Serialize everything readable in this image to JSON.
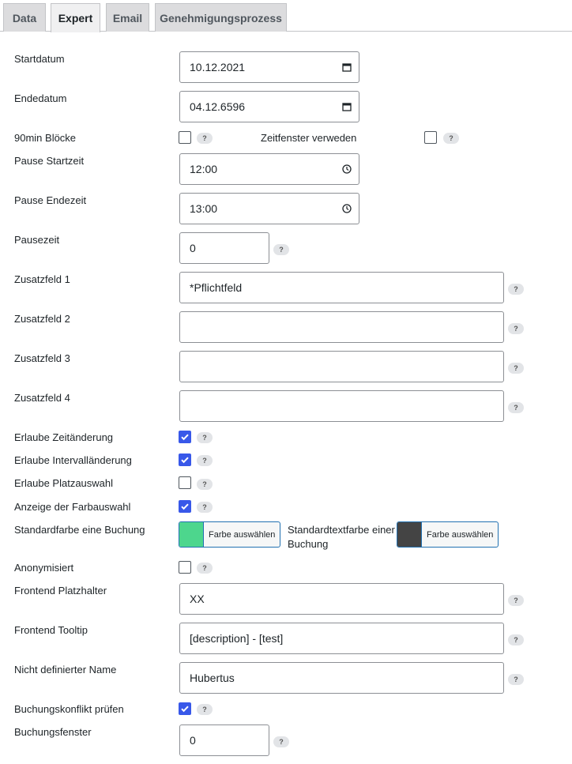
{
  "tabs": [
    {
      "label": "Data"
    },
    {
      "label": "Expert"
    },
    {
      "label": "Email"
    },
    {
      "label": "Genehmigungsprozess"
    }
  ],
  "help_glyph": "?",
  "fields": {
    "startdatum": {
      "label": "Startdatum",
      "value": "10.12.2021"
    },
    "endedatum": {
      "label": "Endedatum",
      "value": "04.12.6596"
    },
    "bloecke90": {
      "label": "90min Blöcke",
      "checked": false
    },
    "zeitfenster": {
      "label": "Zeitfenster verweden",
      "checked": false
    },
    "pause_start": {
      "label": "Pause Startzeit",
      "value": "12:00"
    },
    "pause_ende": {
      "label": "Pause Endezeit",
      "value": "13:00"
    },
    "pausezeit": {
      "label": "Pausezeit",
      "value": "0"
    },
    "zusatz1": {
      "label": "Zusatzfeld 1",
      "value": "*Pflichtfeld"
    },
    "zusatz2": {
      "label": "Zusatzfeld 2",
      "value": ""
    },
    "zusatz3": {
      "label": "Zusatzfeld 3",
      "value": ""
    },
    "zusatz4": {
      "label": "Zusatzfeld 4",
      "value": ""
    },
    "zeitaenderung": {
      "label": "Erlaube Zeitänderung",
      "checked": true
    },
    "intervallaenderung": {
      "label": "Erlaube Intervalländerung",
      "checked": true
    },
    "platzauswahl": {
      "label": "Erlaube Platzauswahl",
      "checked": false
    },
    "farbauswahl": {
      "label": "Anzeige der Farbauswahl",
      "checked": true
    },
    "standardfarbe": {
      "label": "Standardfarbe eine Buchung",
      "button": "Farbe auswählen",
      "color": "#4dd68d"
    },
    "standardtextfarbe": {
      "label_line1": "Standardtextfarbe einer",
      "label_line2": "Buchung",
      "button": "Farbe auswählen",
      "color": "#444444"
    },
    "anonymisiert": {
      "label": "Anonymisiert",
      "checked": false
    },
    "platzhalter": {
      "label": "Frontend Platzhalter",
      "value": "XX"
    },
    "tooltip": {
      "label": "Frontend Tooltip",
      "value": "[description] - [test]"
    },
    "nicht_definiert": {
      "label": "Nicht definierter Name",
      "value": "Hubertus"
    },
    "konflikt": {
      "label": "Buchungskonflikt prüfen",
      "checked": true
    },
    "buchungsfenster": {
      "label": "Buchungsfenster",
      "value": "0"
    }
  }
}
